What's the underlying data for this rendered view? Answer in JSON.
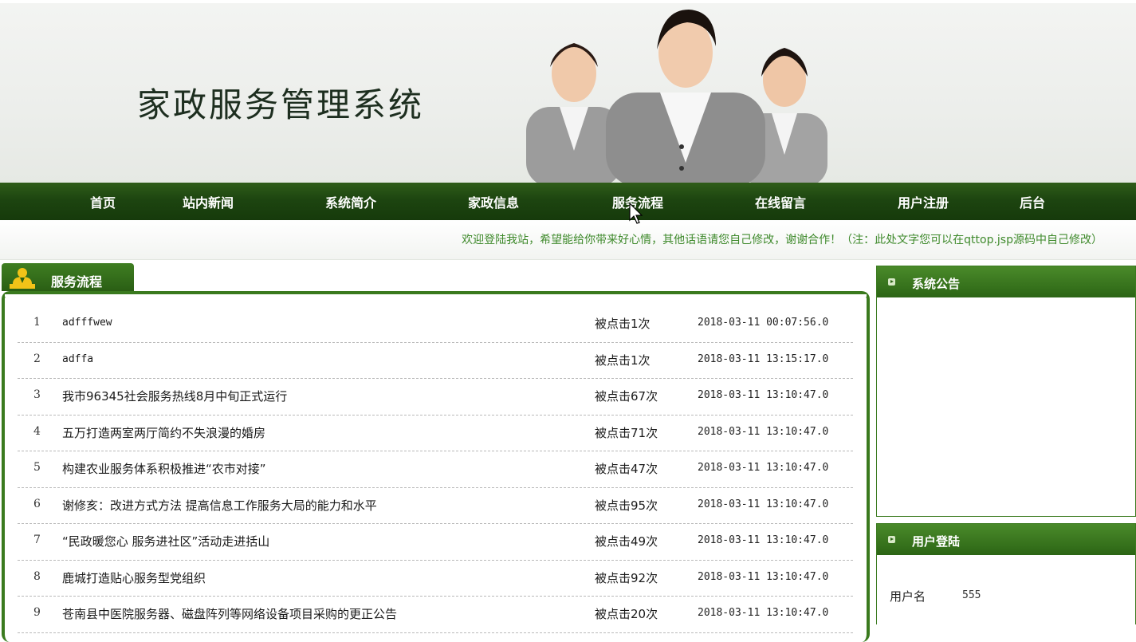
{
  "header": {
    "site_title": "家政服务管理系统"
  },
  "nav": {
    "items": [
      "首页",
      "站内新闻",
      "系统简介",
      "家政信息",
      "服务流程",
      "在线留言",
      "用户注册",
      "后台"
    ]
  },
  "marquee": {
    "text": "欢迎登陆我站，希望能给你带来好心情，其他话语请您自己修改，谢谢合作！（注：此处文字您可以在qttop.jsp源码中自己修改）"
  },
  "main": {
    "panel_title": "服务流程",
    "rows": [
      {
        "num": "1",
        "title": "adfffwew",
        "clicks": "被点击1次",
        "date": "2018-03-11 00:07:56.0"
      },
      {
        "num": "2",
        "title": "adffa",
        "clicks": "被点击1次",
        "date": "2018-03-11 13:15:17.0"
      },
      {
        "num": "3",
        "title": "我市96345社会服务热线8月中旬正式运行",
        "clicks": "被点击67次",
        "date": "2018-03-11 13:10:47.0"
      },
      {
        "num": "4",
        "title": "五万打造两室两厅简约不失浪漫的婚房",
        "clicks": "被点击71次",
        "date": "2018-03-11 13:10:47.0"
      },
      {
        "num": "5",
        "title": "构建农业服务体系积极推进“农市对接”",
        "clicks": "被点击47次",
        "date": "2018-03-11 13:10:47.0"
      },
      {
        "num": "6",
        "title": "谢修亥：改进方式方法 提高信息工作服务大局的能力和水平",
        "clicks": "被点击95次",
        "date": "2018-03-11 13:10:47.0"
      },
      {
        "num": "7",
        "title": "“民政暖您心 服务进社区”活动走进括山",
        "clicks": "被点击49次",
        "date": "2018-03-11 13:10:47.0"
      },
      {
        "num": "8",
        "title": "鹿城打造贴心服务型党组织",
        "clicks": "被点击92次",
        "date": "2018-03-11 13:10:47.0"
      },
      {
        "num": "9",
        "title": "苍南县中医院服务器、磁盘阵列等网络设备项目采购的更正公告",
        "clicks": "被点击20次",
        "date": "2018-03-11 13:10:47.0"
      }
    ]
  },
  "sidebar": {
    "notice_title": "系统公告",
    "login_title": "用户登陆",
    "username_label": "用户名",
    "username_value": "555"
  },
  "colors": {
    "nav_green": "#1d4510",
    "panel_green": "#3a7a1e",
    "welcome_green": "#3f8a2c"
  }
}
